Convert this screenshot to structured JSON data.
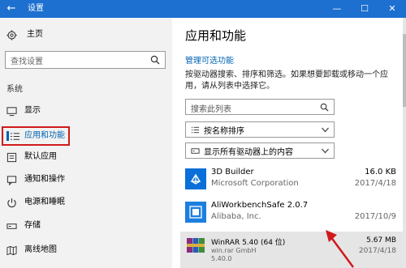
{
  "window": {
    "title": "设置",
    "back_icon": "back-arrow-icon",
    "controls": [
      "minimize-icon",
      "maximize-icon",
      "close-icon"
    ]
  },
  "sidebar": {
    "home": {
      "label": "主页",
      "icon": "gear-icon"
    },
    "search": {
      "placeholder": "查找设置",
      "icon": "search-icon"
    },
    "section_label": "系统",
    "items": [
      {
        "label": "显示",
        "icon": "monitor-icon",
        "active": false
      },
      {
        "label": "应用和功能",
        "icon": "apps-list-icon",
        "active": true
      },
      {
        "label": "默认应用",
        "icon": "default-apps-icon",
        "active": false
      },
      {
        "label": "通知和操作",
        "icon": "notification-icon",
        "active": false
      },
      {
        "label": "电源和睡眠",
        "icon": "power-icon",
        "active": false
      },
      {
        "label": "存储",
        "icon": "storage-icon",
        "active": false
      },
      {
        "label": "离线地图",
        "icon": "map-icon",
        "active": false
      }
    ]
  },
  "main": {
    "title": "应用和功能",
    "manage_link": "管理可选功能",
    "description": "按驱动器搜索、排序和筛选。如果想要卸载或移动一个应用，请从列表中选择它。",
    "search_placeholder": "搜索此列表",
    "sort_dropdown": "按名称排序",
    "drive_dropdown": "显示所有驱动器上的内容",
    "apps": [
      {
        "name": "3D Builder",
        "publisher": "Microsoft Corporation",
        "version": "",
        "size": "16.0 KB",
        "date": "2017/4/18",
        "icon": "3d-builder-icon",
        "selected": false
      },
      {
        "name": "AliWorkbenchSafe 2.0.7",
        "publisher": "Alibaba, Inc.",
        "version": "",
        "size": "",
        "date": "2017/10/9",
        "icon": "aliworkbench-icon",
        "selected": false
      },
      {
        "name": "WinRAR 5.40 (64 位)",
        "publisher": "win.rar GmbH",
        "version": "5.40.0",
        "size": "5.67 MB",
        "date": "2017/4/18",
        "icon": "winrar-icon",
        "selected": true
      }
    ]
  },
  "colors": {
    "titlebar": "#1d6fd0",
    "accent": "#0063b1",
    "highlight_border": "#d01a1a"
  }
}
